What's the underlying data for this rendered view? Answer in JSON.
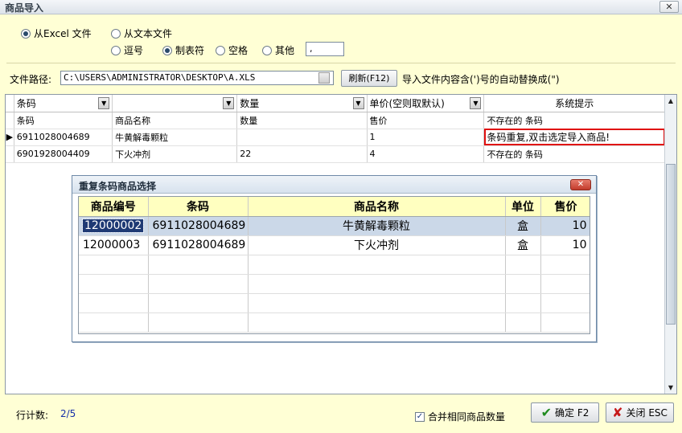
{
  "window": {
    "title": "商品导入",
    "close_glyph": "✕"
  },
  "source": {
    "excel_label": "从Excel 文件",
    "text_label": "从文本文件",
    "comma_label": "逗号",
    "tab_label": "制表符",
    "space_label": "空格",
    "other_label": "其他",
    "other_value": ","
  },
  "file": {
    "path_label": "文件路径:",
    "path_value": "C:\\USERS\\ADMINISTRATOR\\DESKTOP\\A.XLS",
    "refresh_label": "刷新(F12)",
    "hint": "导入文件内容含(')号的自动替换成(\")"
  },
  "grid": {
    "header": {
      "col1": "条码",
      "col2": "",
      "col3": "数量",
      "col4": "单价(空则取默认)",
      "col5": "系统提示"
    },
    "rows": [
      {
        "indicator": "",
        "c1": "条码",
        "c2": "商品名称",
        "c3": "数量",
        "c4": "售价",
        "c5": "不存在的 条码"
      },
      {
        "indicator": "▶",
        "c1": "6911028004689",
        "c2": "牛黄解毒颗粒",
        "c3": "",
        "c4": "1",
        "c5": "条码重复,双击选定导入商品!"
      },
      {
        "indicator": "",
        "c1": "6901928004409",
        "c2": "下火冲剂",
        "c3": "22",
        "c4": "4",
        "c5": "不存在的 条码"
      }
    ]
  },
  "dialog": {
    "title": "重复条码商品选择",
    "close_glyph": "✕",
    "headers": [
      "商品编号",
      "条码",
      "商品名称",
      "单位",
      "售价"
    ],
    "rows": [
      {
        "id": "12000002",
        "barcode": "6911028004689",
        "name": "牛黄解毒颗粒",
        "unit": "盒",
        "price": "10"
      },
      {
        "id": "12000003",
        "barcode": "6911028004689",
        "name": "下火冲剂",
        "unit": "盒",
        "price": "10"
      }
    ]
  },
  "footer": {
    "count_label": "行计数:",
    "count_value": "2/5",
    "merge_label": "合并相同商品数量",
    "ok_label": "确定 F2",
    "cancel_label": "关闭 ESC"
  },
  "colors": {
    "background": "#ffffd5",
    "warn_border": "#e01010",
    "dialog_header": "#ffffc0",
    "selected_row": "#cbd8e8"
  },
  "icons": {
    "ok": "check-icon",
    "cancel": "x-icon",
    "scroll_up": "chevron-up-icon",
    "scroll_down": "chevron-down-icon"
  }
}
